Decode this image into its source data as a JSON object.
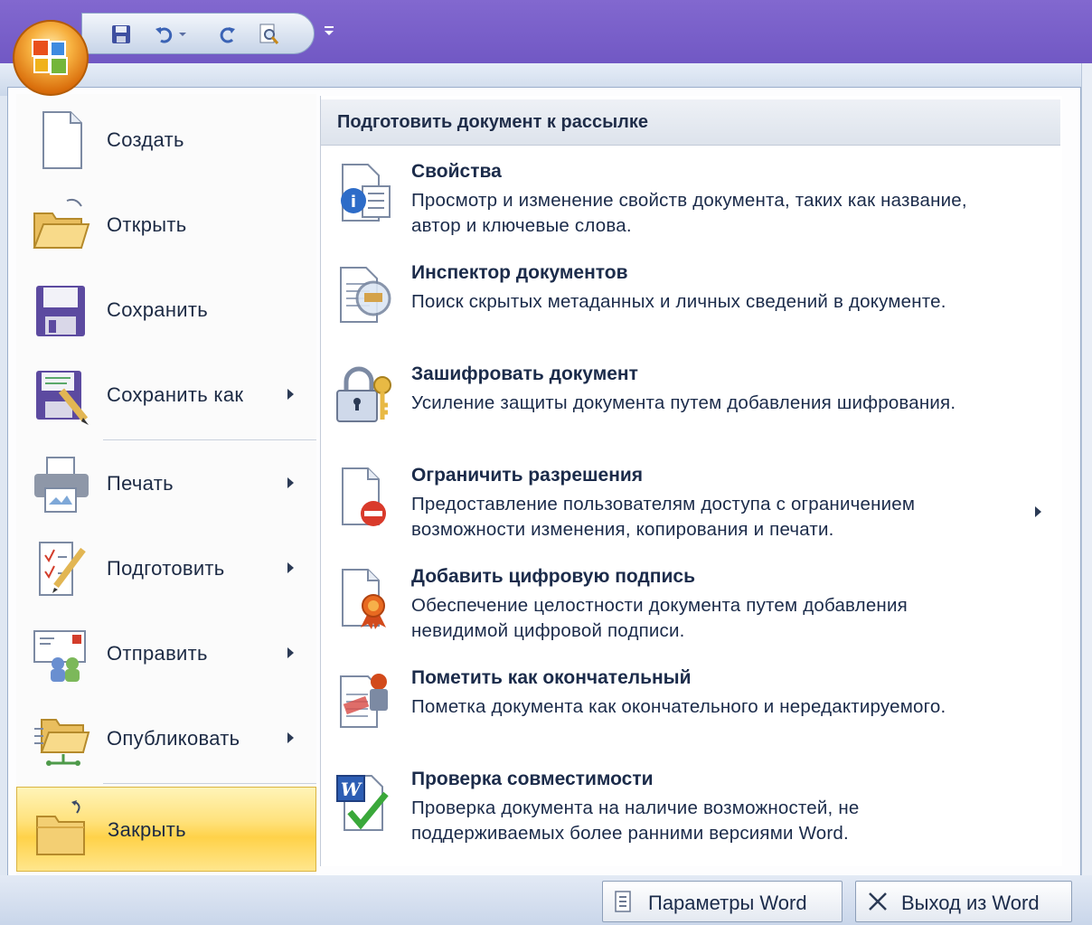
{
  "quick_access": {
    "save_icon": "save-icon",
    "undo_icon": "undo-icon",
    "redo_icon": "redo-icon",
    "print_preview_icon": "print-preview-icon",
    "customize_icon": "chevron-down-icon"
  },
  "office_button": {
    "icon": "office-logo-icon"
  },
  "left_menu": {
    "items": [
      {
        "label": "Создать",
        "icon": "new-document-icon",
        "submenu": false
      },
      {
        "label": "Открыть",
        "icon": "open-folder-icon",
        "submenu": false
      },
      {
        "label": "Сохранить",
        "icon": "save-icon",
        "submenu": false
      },
      {
        "label": "Сохранить как",
        "icon": "save-as-icon",
        "submenu": true
      },
      {
        "label": "Печать",
        "icon": "printer-icon",
        "submenu": true
      },
      {
        "label": "Подготовить",
        "icon": "prepare-icon",
        "submenu": true
      },
      {
        "label": "Отправить",
        "icon": "send-icon",
        "submenu": true
      },
      {
        "label": "Опубликовать",
        "icon": "publish-icon",
        "submenu": true
      },
      {
        "label": "Закрыть",
        "icon": "close-folder-icon",
        "submenu": false,
        "selected": true
      }
    ]
  },
  "right_panel": {
    "header": "Подготовить документ к рассылке",
    "items": [
      {
        "title": "Свойства",
        "description": "Просмотр и изменение свойств документа, таких как название, автор и ключевые слова.",
        "icon": "properties-icon"
      },
      {
        "title": "Инспектор документов",
        "description": "Поиск скрытых метаданных и личных сведений в документе.",
        "icon": "inspect-document-icon"
      },
      {
        "title": "Зашифровать документ",
        "description": "Усиление защиты документа путем добавления шифрования.",
        "icon": "encrypt-lock-icon"
      },
      {
        "title": "Ограничить разрешения",
        "description": "Предоставление пользователям доступа с ограничением возможности изменения, копирования и печати.",
        "icon": "restrict-permission-icon",
        "submenu": true
      },
      {
        "title": "Добавить цифровую подпись",
        "description": "Обеспечение целостности документа путем добавления невидимой цифровой подписи.",
        "icon": "digital-signature-icon"
      },
      {
        "title": "Пометить как окончательный",
        "description": "Пометка документа как окончательного и нередактируемого.",
        "icon": "mark-final-icon"
      },
      {
        "title": "Проверка совместимости",
        "description": "Проверка документа на наличие возможностей, не поддерживаемых более ранними версиями Word.",
        "icon": "compatibility-check-icon"
      }
    ]
  },
  "bottom": {
    "options_label": "Параметры Word",
    "exit_label": "Выход из Word"
  },
  "colors": {
    "titlebar": "#7158c4",
    "selected_item": "#ffd249",
    "text": "#1b2b4a"
  }
}
